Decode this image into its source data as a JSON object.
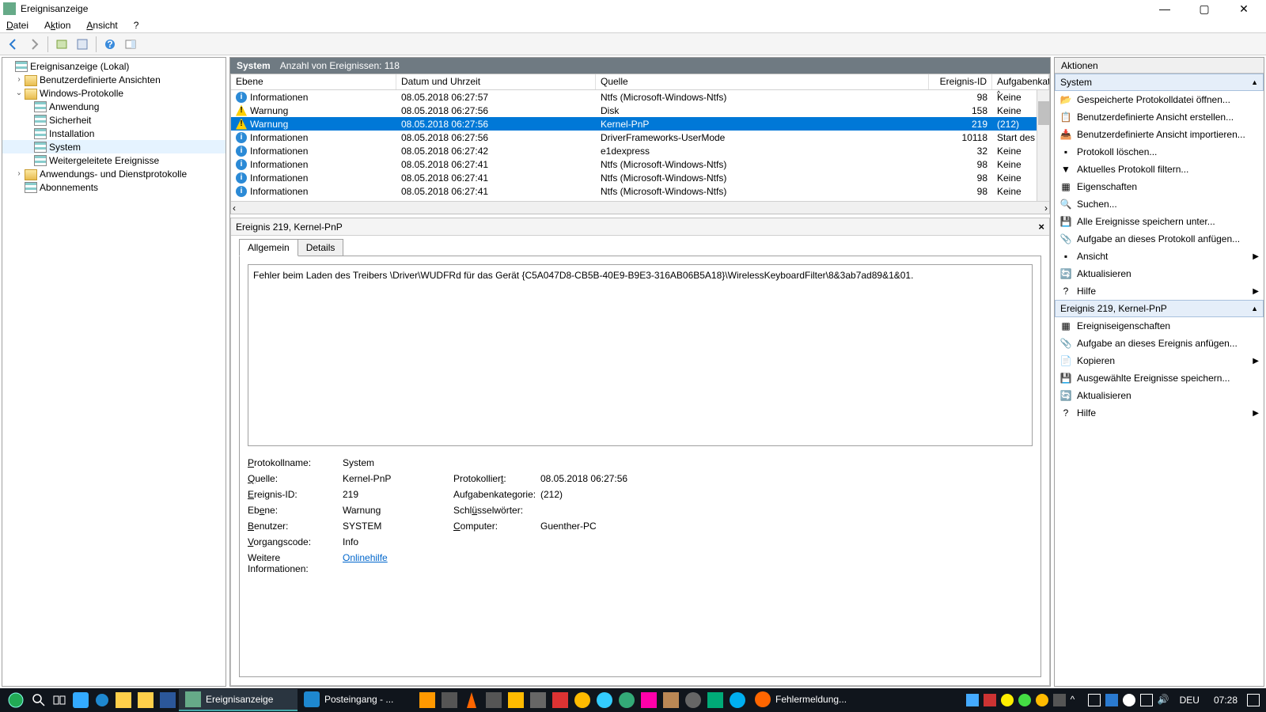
{
  "window": {
    "title": "Ereignisanzeige"
  },
  "menu": {
    "file": "Datei",
    "action": "Aktion",
    "view": "Ansicht",
    "help": "?"
  },
  "tree": {
    "root": "Ereignisanzeige (Lokal)",
    "custom": "Benutzerdefinierte Ansichten",
    "winlogs": "Windows-Protokolle",
    "items": [
      "Anwendung",
      "Sicherheit",
      "Installation",
      "System",
      "Weitergeleitete Ereignisse"
    ],
    "apps": "Anwendungs- und Dienstprotokolle",
    "subs": "Abonnements"
  },
  "center": {
    "title": "System",
    "count_label": "Anzahl von Ereignissen: 118"
  },
  "columns": {
    "level": "Ebene",
    "date": "Datum und Uhrzeit",
    "source": "Quelle",
    "eid": "Ereignis-ID",
    "task": "Aufgabenkate"
  },
  "rows": [
    {
      "lv": "Informationen",
      "icn": "info",
      "dt": "08.05.2018 06:27:57",
      "src": "Ntfs (Microsoft-Windows-Ntfs)",
      "id": "98",
      "tk": "Keine"
    },
    {
      "lv": "Warnung",
      "icn": "warn",
      "dt": "08.05.2018 06:27:56",
      "src": "Disk",
      "id": "158",
      "tk": "Keine"
    },
    {
      "lv": "Warnung",
      "icn": "warn",
      "dt": "08.05.2018 06:27:56",
      "src": "Kernel-PnP",
      "id": "219",
      "tk": "(212)",
      "sel": true
    },
    {
      "lv": "Informationen",
      "icn": "info",
      "dt": "08.05.2018 06:27:56",
      "src": "DriverFrameworks-UserMode",
      "id": "10118",
      "tk": "Start des UMD"
    },
    {
      "lv": "Informationen",
      "icn": "info",
      "dt": "08.05.2018 06:27:42",
      "src": "e1dexpress",
      "id": "32",
      "tk": "Keine"
    },
    {
      "lv": "Informationen",
      "icn": "info",
      "dt": "08.05.2018 06:27:41",
      "src": "Ntfs (Microsoft-Windows-Ntfs)",
      "id": "98",
      "tk": "Keine"
    },
    {
      "lv": "Informationen",
      "icn": "info",
      "dt": "08.05.2018 06:27:41",
      "src": "Ntfs (Microsoft-Windows-Ntfs)",
      "id": "98",
      "tk": "Keine"
    },
    {
      "lv": "Informationen",
      "icn": "info",
      "dt": "08.05.2018 06:27:41",
      "src": "Ntfs (Microsoft-Windows-Ntfs)",
      "id": "98",
      "tk": "Keine"
    }
  ],
  "detail": {
    "header": "Ereignis 219, Kernel-PnP",
    "tab_general": "Allgemein",
    "tab_details": "Details",
    "message": "Fehler beim Laden des Treibers \\Driver\\WUDFRd für das Gerät {C5A047D8-CB5B-40E9-B9E3-316AB06B5A18}\\WirelessKeyboardFilter\\8&3ab7ad89&1&01.",
    "labels": {
      "logname": "Protokollname:",
      "source": "Quelle:",
      "eid": "Ereignis-ID:",
      "level": "Ebene:",
      "user": "Benutzer:",
      "opcode": "Vorgangscode:",
      "more": "Weitere Informationen:",
      "logged": "Protokolliert:",
      "task": "Aufgabenkategorie:",
      "keywords": "Schlüsselwörter:",
      "computer": "Computer:"
    },
    "values": {
      "logname": "System",
      "source": "Kernel-PnP",
      "eid": "219",
      "level": "Warnung",
      "user": "SYSTEM",
      "opcode": "Info",
      "logged": "08.05.2018 06:27:56",
      "task": "(212)",
      "keywords": "",
      "computer": "Guenther-PC",
      "help": "Onlinehilfe"
    }
  },
  "actions": {
    "title": "Aktionen",
    "sec1": "System",
    "sec2": "Ereignis 219, Kernel-PnP",
    "sys": [
      {
        "t": "Gespeicherte Protokolldatei öffnen...",
        "i": "open"
      },
      {
        "t": "Benutzerdefinierte Ansicht erstellen...",
        "i": "newview"
      },
      {
        "t": "Benutzerdefinierte Ansicht importieren...",
        "i": "import"
      },
      {
        "t": "Protokoll löschen...",
        "i": "clear"
      },
      {
        "t": "Aktuelles Protokoll filtern...",
        "i": "filter"
      },
      {
        "t": "Eigenschaften",
        "i": "props"
      },
      {
        "t": "Suchen...",
        "i": "find"
      },
      {
        "t": "Alle Ereignisse speichern unter...",
        "i": "save"
      },
      {
        "t": "Aufgabe an dieses Protokoll anfügen...",
        "i": "task"
      },
      {
        "t": "Ansicht",
        "i": "view",
        "sub": true
      },
      {
        "t": "Aktualisieren",
        "i": "refresh"
      },
      {
        "t": "Hilfe",
        "i": "help",
        "sub": true
      }
    ],
    "evt": [
      {
        "t": "Ereigniseigenschaften",
        "i": "props"
      },
      {
        "t": "Aufgabe an dieses Ereignis anfügen...",
        "i": "task"
      },
      {
        "t": "Kopieren",
        "i": "copy",
        "sub": true
      },
      {
        "t": "Ausgewählte Ereignisse speichern...",
        "i": "save"
      },
      {
        "t": "Aktualisieren",
        "i": "refresh"
      },
      {
        "t": "Hilfe",
        "i": "help",
        "sub": true
      }
    ]
  },
  "taskbar": {
    "apps": [
      {
        "t": "Ereignisanzeige",
        "act": true
      },
      {
        "t": "Posteingang - ...",
        "act": false
      },
      {
        "t": "Fehlermeldung...",
        "act": false,
        "ff": true
      }
    ],
    "lang": "DEU",
    "clock": "07:28"
  }
}
